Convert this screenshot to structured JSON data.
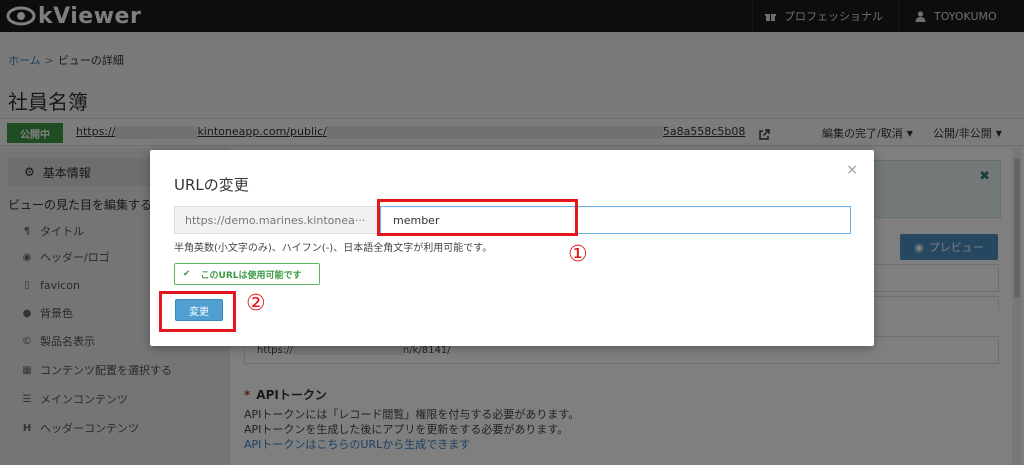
{
  "header": {
    "app_name": "kViewer",
    "plan_label": "プロフェッショナル",
    "user_name": "TOYOKUMO"
  },
  "breadcrumb": {
    "home": "ホーム",
    "separator": ">",
    "current": "ビューの詳細"
  },
  "page": {
    "title": "社員名簿",
    "status_badge": "公開中",
    "public_url_part1": "https://",
    "public_url_part2": "kintoneapp.com/public/",
    "public_url_part3": "5a8a558c5b08",
    "edit_done_label": "編集の完了/取消",
    "publish_toggle_label": "公開/非公開"
  },
  "sidebar": {
    "basic_info": "基本情報",
    "section_heading": "ビューの見た目を編集する",
    "items": [
      {
        "icon": "paragraph-icon",
        "label": "タイトル"
      },
      {
        "icon": "eye-icon",
        "label": "ヘッダー/ロゴ"
      },
      {
        "icon": "bookmark-icon",
        "label": "favicon"
      },
      {
        "icon": "tint-icon",
        "label": "背景色"
      },
      {
        "icon": "copyright-icon",
        "label": "製品名表示"
      },
      {
        "icon": "grid-icon",
        "label": "コンテンツ配置を選択する"
      },
      {
        "icon": "list-icon",
        "label": "メインコンテンツ"
      },
      {
        "icon": "header-icon",
        "label": "ヘッダーコンテンツ"
      }
    ]
  },
  "content": {
    "preview_label": "プレビュー",
    "api_url_prefix": "https://",
    "api_url_suffix": "n/k/8141/",
    "api_token_title": "APIトークン",
    "api_required_mark": "*",
    "api_line1": "APIトークンには「レコード閲覧」権限を付与する必要があります。",
    "api_line2": "APIトークンを生成した後にアプリを更新をする必要があります。",
    "api_line3": "APIトークンはこちらのURLから生成できます"
  },
  "modal": {
    "title": "URLの変更",
    "close_symbol": "×",
    "url_prefix": "https://demo.marines.kintonea···",
    "url_value": "member",
    "help_text": "半角英数(小文字のみ)、ハイフン(-)、日本語全角文字が利用可能です。",
    "available_message": "このURLは使用可能です",
    "submit_label": "変更"
  },
  "annotations": {
    "step1": "①",
    "step2": "②",
    "color": "#e3161c"
  },
  "colors": {
    "topbar": "#1b1b1b",
    "published_green": "#3c9a43",
    "primary_blue": "#4f9fd0",
    "link_blue": "#3a80c8"
  }
}
